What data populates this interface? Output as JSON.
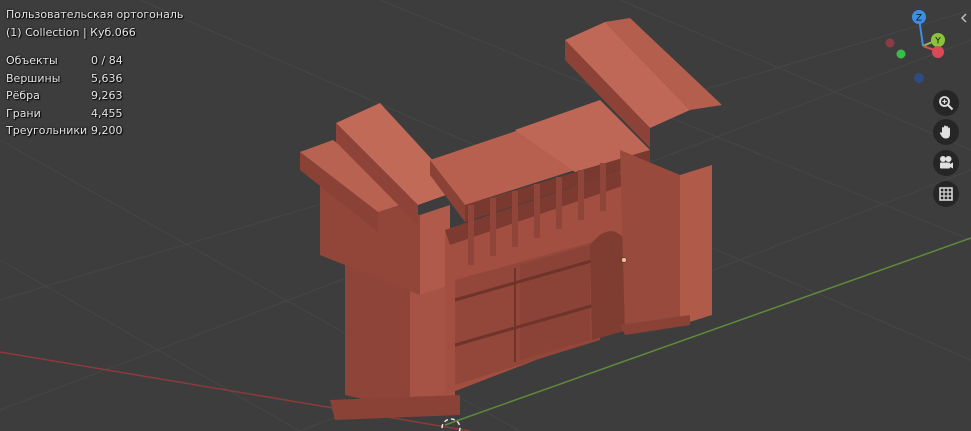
{
  "viewport": {
    "view_name": "Пользовательская ортогональ",
    "collection_info": "(1) Collection | Куб.066"
  },
  "stats": {
    "rows": [
      {
        "label": "Объекты",
        "value": "0 / 84"
      },
      {
        "label": "Вершины",
        "value": "5,636"
      },
      {
        "label": "Рёбра",
        "value": "9,263"
      },
      {
        "label": "Грани",
        "value": "4,455"
      },
      {
        "label": "Треугольники",
        "value": "9,200"
      }
    ]
  },
  "gizmo": {
    "z_label": "Z",
    "y_label": "Y",
    "colors": {
      "x": "#d94a59",
      "y": "#8ac43a",
      "z": "#3c8ee6"
    }
  },
  "navigation": {
    "buttons": [
      "zoom-icon",
      "hand-pan-icon",
      "camera-icon",
      "grid-perspective-icon"
    ]
  },
  "model": {
    "color": "#a35042"
  }
}
